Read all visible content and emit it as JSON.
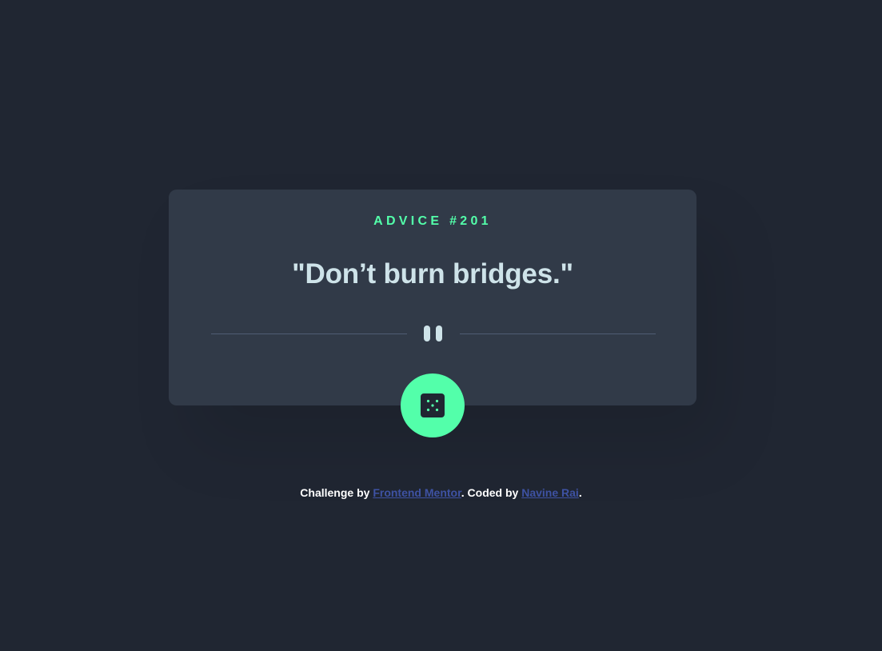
{
  "card": {
    "advice_label": "ADVICE #201",
    "advice_text": "\"Don’t burn bridges.\""
  },
  "dice_button": {
    "icon": "dice-icon"
  },
  "footer": {
    "prefix": "Challenge by ",
    "link1": "Frontend Mentor",
    "middle": ". Coded by ",
    "link2": "Navine Rai",
    "suffix": "."
  },
  "colors": {
    "background": "#202632",
    "card": "#313a48",
    "accent": "#53ffaa",
    "text": "#cee3e9",
    "divider": "#4f5d74",
    "link": "#3e52a3"
  }
}
